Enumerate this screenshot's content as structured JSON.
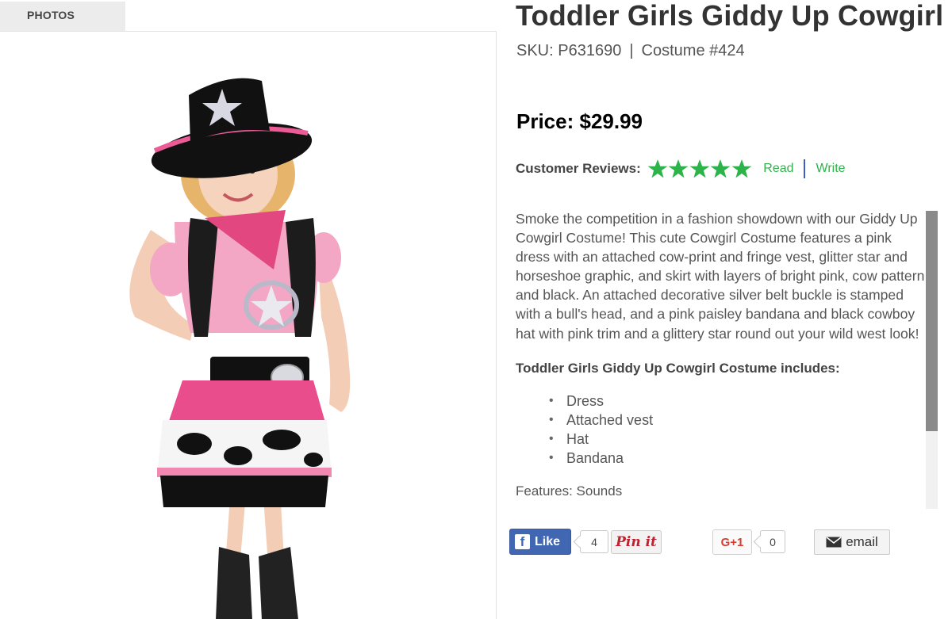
{
  "gallery": {
    "tab_label": "PHOTOS"
  },
  "product": {
    "title": "Toddler Girls Giddy Up Cowgirl",
    "sku": "SKU: P631690",
    "separator": "|",
    "costume_number": "Costume #424",
    "price": "Price: $29.99"
  },
  "reviews": {
    "label": "Customer Reviews:",
    "rating": 5,
    "max_rating": 5,
    "read_label": "Read",
    "write_label": "Write",
    "star_color": "#2db34a"
  },
  "description": {
    "paragraph": "Smoke the competition in a fashion showdown with our Giddy Up Cowgirl Costume! This cute Cowgirl Costume features a pink dress with an attached cow-print and fringe vest, glitter star and horseshoe graphic, and skirt with layers of bright pink, cow pattern and black. An attached decorative silver belt buckle is stamped with a bull's head, and a pink paisley bandana and black cowboy hat with pink trim and a glittery star round out your wild west look!",
    "includes_title": "Toddler Girls Giddy Up Cowgirl Costume includes:",
    "includes": [
      "Dress",
      "Attached vest",
      "Hat",
      "Bandana"
    ],
    "extra_line": "Features: Sounds"
  },
  "social": {
    "like_label": "Like",
    "like_count": "4",
    "pin_label": "Pin it",
    "gplus_label": "G+1",
    "gplus_count": "0",
    "email_label": "email",
    "facebook_color": "#4267b2",
    "pinterest_color": "#c0202f",
    "gplus_color": "#d73d32"
  },
  "icons": [
    "facebook-icon",
    "star-icon",
    "email-icon"
  ]
}
